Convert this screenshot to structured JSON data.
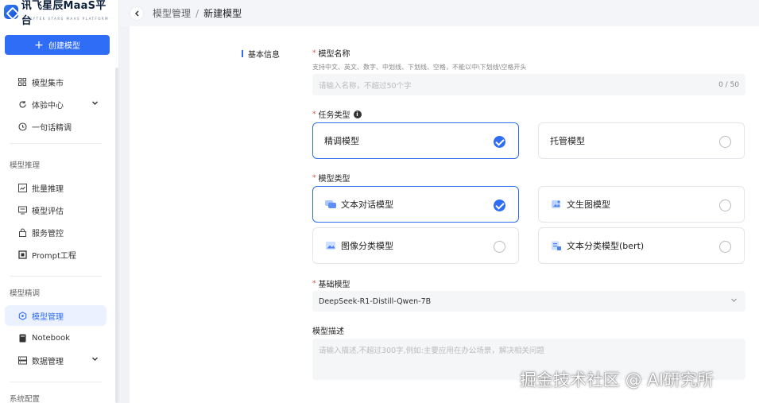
{
  "brand": {
    "name": "讯飞星辰MaaS平台",
    "subtitle": "IFLYTEK STARS MAAS PLATFORM"
  },
  "sidebar": {
    "create_label": "创建模型",
    "group1": [
      {
        "label": "模型集市",
        "icon": "grid-icon"
      },
      {
        "label": "体验中心",
        "icon": "refresh-icon",
        "expandable": true
      },
      {
        "label": "一句话精调",
        "icon": "clock-icon"
      }
    ],
    "section_inference": "模型推理",
    "group2": [
      {
        "label": "批量推理",
        "icon": "chart-icon"
      },
      {
        "label": "模型评估",
        "icon": "monitor-icon"
      },
      {
        "label": "服务管控",
        "icon": "lock-icon"
      },
      {
        "label": "Prompt工程",
        "icon": "square-icon"
      }
    ],
    "section_finetune": "模型精调",
    "group3": [
      {
        "label": "模型管理",
        "icon": "cube-icon",
        "active": true
      },
      {
        "label": "Notebook",
        "icon": "notebook-icon"
      },
      {
        "label": "数据管理",
        "icon": "database-icon",
        "expandable": true
      }
    ],
    "section_system": "系统配置"
  },
  "breadcrumb": {
    "parent": "模型管理",
    "separator": "/",
    "current": "新建模型"
  },
  "form": {
    "section_title": "基本信息",
    "name": {
      "label": "模型名称",
      "hint": "支持中文、英文、数字、中划线、下划线、空格，不能以中\\下划线\\空格开头",
      "placeholder": "请输入名称，不超过50个字",
      "count": "0 / 50"
    },
    "task_type": {
      "label": "任务类型",
      "options": [
        {
          "label": "精调模型",
          "checked": true
        },
        {
          "label": "托管模型",
          "checked": false
        }
      ]
    },
    "model_type": {
      "label": "模型类型",
      "options": [
        {
          "label": "文本对话模型",
          "checked": true
        },
        {
          "label": "文生图模型",
          "checked": false
        },
        {
          "label": "图像分类模型",
          "checked": false
        },
        {
          "label": "文本分类模型(bert)",
          "checked": false
        }
      ]
    },
    "base_model": {
      "label": "基础模型",
      "value": "DeepSeek-R1-Distill-Qwen-7B"
    },
    "description": {
      "label": "模型描述",
      "placeholder": "请输入描述,不超过300字,例如:主要应用在办公场景，解决相关问题"
    }
  },
  "watermark": "掘金技术社区 @ AI研究所",
  "colors": {
    "primary": "#2f6df6",
    "required": "#e5483c"
  }
}
